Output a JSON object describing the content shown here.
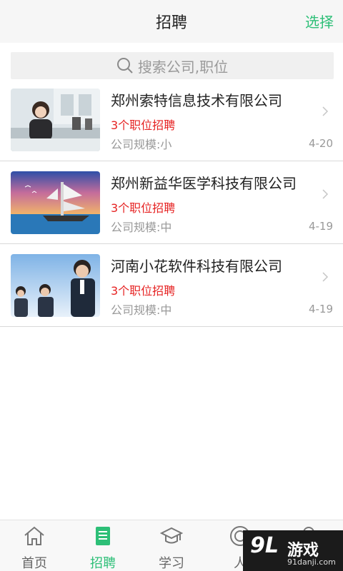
{
  "header": {
    "title": "招聘",
    "action": "选择"
  },
  "search": {
    "placeholder": "搜索公司,职位"
  },
  "companies": [
    {
      "name": "郑州索特信息技术有限公司",
      "jobs": "3个职位招聘",
      "scale": "公司规模:小",
      "date": "4-20"
    },
    {
      "name": "郑州新益华医学科技有限公司",
      "jobs": "3个职位招聘",
      "scale": "公司规模:中",
      "date": "4-19"
    },
    {
      "name": "河南小花软件科技有限公司",
      "jobs": "3个职位招聘",
      "scale": "公司规模:中",
      "date": "4-19"
    }
  ],
  "tabs": [
    {
      "label": "首页",
      "icon": "home-icon"
    },
    {
      "label": "招聘",
      "icon": "document-icon"
    },
    {
      "label": "学习",
      "icon": "graduation-cap-icon"
    },
    {
      "label": "人",
      "icon": "target-icon"
    },
    {
      "label": "",
      "icon": "user-icon"
    }
  ],
  "watermark": {
    "logo": "9L",
    "name": "游戏",
    "url": "91danji.com"
  },
  "colors": {
    "accent": "#2dbf77",
    "jobs": "#e62222",
    "muted": "#999999"
  }
}
